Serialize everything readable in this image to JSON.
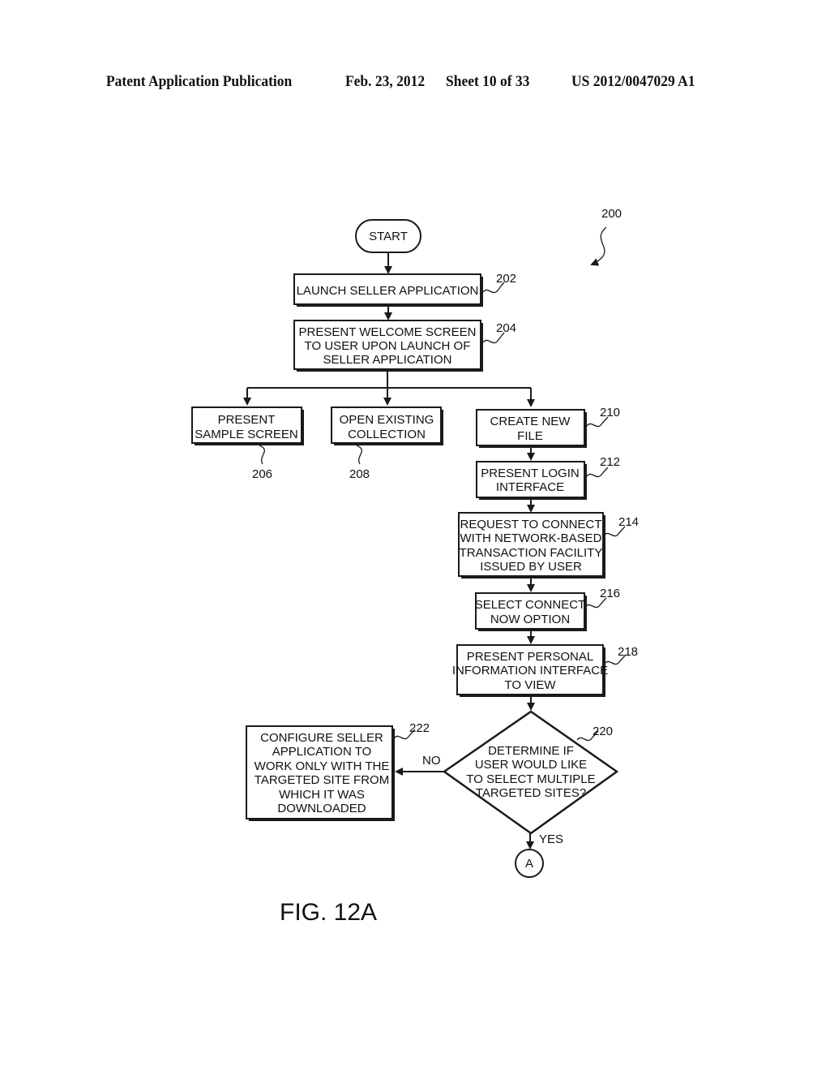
{
  "header": {
    "publication": "Patent Application Publication",
    "date": "Feb. 23, 2012",
    "sheet": "Sheet 10 of 33",
    "number": "US 2012/0047029 A1"
  },
  "figure": {
    "label": "FIG. 12A",
    "ref": "200"
  },
  "nodes": {
    "start": {
      "lines": [
        "START"
      ]
    },
    "n202": {
      "ref": "202",
      "lines": [
        "LAUNCH SELLER APPLICATION"
      ]
    },
    "n204": {
      "ref": "204",
      "lines": [
        "PRESENT WELCOME SCREEN",
        "TO USER UPON LAUNCH OF",
        "SELLER APPLICATION"
      ]
    },
    "n206": {
      "ref": "206",
      "lines": [
        "PRESENT",
        "SAMPLE SCREEN"
      ]
    },
    "n208": {
      "ref": "208",
      "lines": [
        "OPEN EXISTING",
        "COLLECTION"
      ]
    },
    "n210": {
      "ref": "210",
      "lines": [
        "CREATE NEW",
        "FILE"
      ]
    },
    "n212": {
      "ref": "212",
      "lines": [
        "PRESENT LOGIN",
        "INTERFACE"
      ]
    },
    "n214": {
      "ref": "214",
      "lines": [
        "REQUEST TO CONNECT",
        "WITH NETWORK-BASED",
        "TRANSACTION FACILITY",
        "ISSUED BY USER"
      ]
    },
    "n216": {
      "ref": "216",
      "lines": [
        "SELECT CONNECT",
        "NOW OPTION"
      ]
    },
    "n218": {
      "ref": "218",
      "lines": [
        "PRESENT PERSONAL",
        "INFORMATION INTERFACE",
        "TO VIEW"
      ]
    },
    "n220": {
      "ref": "220",
      "lines": [
        "DETERMINE IF",
        "USER WOULD LIKE",
        "TO SELECT MULTIPLE",
        "TARGETED SITES?"
      ]
    },
    "n222": {
      "ref": "222",
      "lines": [
        "CONFIGURE SELLER",
        "APPLICATION TO",
        "WORK ONLY WITH THE",
        "TARGETED SITE FROM",
        "WHICH IT WAS",
        "DOWNLOADED"
      ]
    },
    "connector": {
      "lines": [
        "A"
      ]
    }
  },
  "edges": {
    "no_label": "NO",
    "yes_label": "YES"
  }
}
